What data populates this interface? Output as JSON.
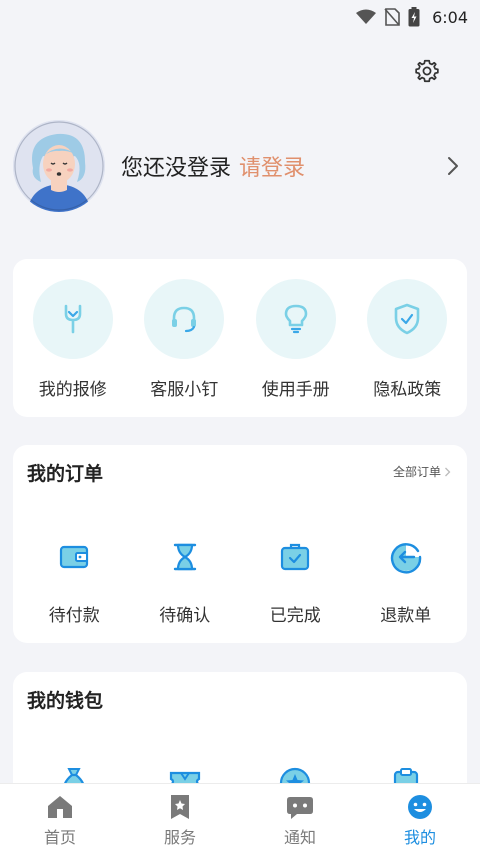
{
  "status_bar": {
    "time": "6:04",
    "icons": [
      "wifi-icon",
      "no-sim-icon",
      "battery-charging-icon"
    ]
  },
  "header": {
    "settings_icon": "gear-icon"
  },
  "profile": {
    "status_text": "您还没登录",
    "login_link": "请登录",
    "login_link_color": "#e0906d"
  },
  "quick_actions": [
    {
      "label": "我的报修",
      "icon": "wrench-icon"
    },
    {
      "label": "客服小钉",
      "icon": "headset-icon"
    },
    {
      "label": "使用手册",
      "icon": "lightbulb-icon"
    },
    {
      "label": "隐私政策",
      "icon": "shield-check-icon"
    }
  ],
  "orders": {
    "title": "我的订单",
    "view_all": "全部订单",
    "items": [
      {
        "label": "待付款",
        "icon": "wallet-icon"
      },
      {
        "label": "待确认",
        "icon": "hourglass-icon"
      },
      {
        "label": "已完成",
        "icon": "briefcase-check-icon"
      },
      {
        "label": "退款单",
        "icon": "refund-icon"
      }
    ]
  },
  "wallet": {
    "title": "我的钱包",
    "icons": [
      "money-bag-icon",
      "ticket-icon",
      "star-coin-icon",
      "clipboard-icon"
    ]
  },
  "tabs": [
    {
      "label": "首页",
      "icon": "home-icon",
      "active": false
    },
    {
      "label": "服务",
      "icon": "bookmark-icon",
      "active": false
    },
    {
      "label": "通知",
      "icon": "chat-icon",
      "active": false
    },
    {
      "label": "我的",
      "icon": "smiley-icon",
      "active": true
    }
  ],
  "colors": {
    "accent": "#1d8ee0",
    "icon_blue": "#3aa8e8",
    "icon_bg_light": "#e8f6f8",
    "background": "#f3f4f8"
  }
}
